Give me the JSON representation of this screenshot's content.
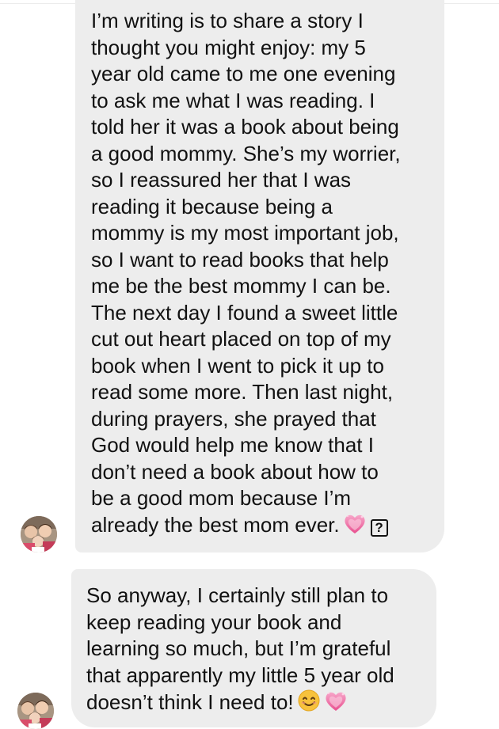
{
  "messages": [
    {
      "lines": [
        "I’m writing is to share a story I",
        "thought you might enjoy: my 5",
        "year old came to me one evening",
        "to ask me what I was reading. I",
        "told her it was a book about being",
        "a good mommy. She’s my worrier,",
        "so I reassured her that I was",
        "reading it because being a",
        "mommy is my most important job,",
        "so I want to read books that help",
        "me be the best mommy I can be.",
        "The next day I found a sweet little",
        "cut out heart placed on top of my",
        "book when I went to pick it up to",
        "read some more. Then last night,",
        "during prayers, she prayed that",
        "God would help me know that I",
        "don’t need a book about how to",
        "be a good mom because I’m",
        "already the best mom ever."
      ],
      "trailing_icons": [
        "sparkling-heart-icon",
        "missing-glyph-icon"
      ],
      "missing_glyph_text": "?"
    },
    {
      "lines": [
        "So anyway, I certainly still plan to",
        "keep reading your book and",
        "learning so much, but I’m grateful",
        "that apparently my little 5 year old",
        "doesn’t think I need to!"
      ],
      "trailing_icons": [
        "smiling-face-icon",
        "sparkling-heart-icon"
      ]
    }
  ],
  "colors": {
    "bubble": "#ededed",
    "text": "#111111",
    "heart": "#e8508f",
    "smile": "#f7c23c"
  }
}
